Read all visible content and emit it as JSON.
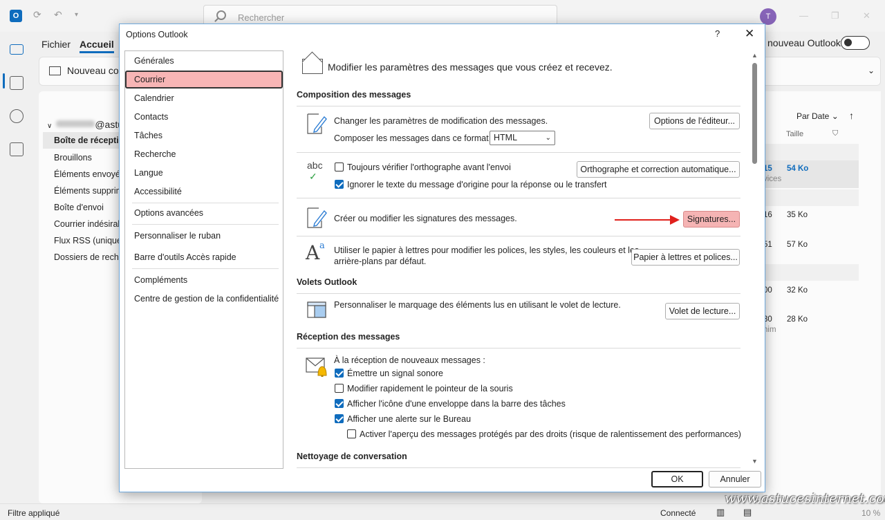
{
  "app": {
    "search_placeholder": "Rechercher",
    "avatar_initial": "T",
    "tabs": [
      "Fichier",
      "Accueil"
    ],
    "new_mail_label": "Nouveau cou",
    "toggle_label": "nouveau Outlook",
    "account_suffix": "@astuc",
    "folders": [
      "Boîte de réceptio",
      "Brouillons",
      "Éléments envoyé",
      "Éléments supprim",
      "Boîte d'envoi",
      "Courrier indésirab",
      "Flux RSS (uniquem",
      "Dossiers de recher"
    ],
    "sort_label": "Par Date",
    "size_col": "Taille",
    "messages": [
      {
        "time": "15",
        "size": "54 Ko",
        "sub": "vices"
      },
      {
        "time": "16",
        "size": "35 Ko",
        "sub": ""
      },
      {
        "time": "51",
        "size": "57 Ko",
        "sub": ""
      },
      {
        "time": "00",
        "size": "32 Ko",
        "sub": ""
      },
      {
        "time": "30",
        "size": "28 Ko",
        "sub": "him"
      }
    ],
    "status_left": "Filtre appliqué",
    "status_connected": "Connecté",
    "status_zoom": "10 %",
    "watermark": "www.astucesinternet.com"
  },
  "dialog": {
    "title": "Options Outlook",
    "help": "?",
    "close": "✕",
    "nav": [
      "Générales",
      "Courrier",
      "Calendrier",
      "Contacts",
      "Tâches",
      "Recherche",
      "Langue",
      "Accessibilité",
      "Options avancées",
      "Personnaliser le ruban",
      "Barre d'outils Accès rapide",
      "Compléments",
      "Centre de gestion de la confidentialité"
    ],
    "header": "Modifier les paramètres des messages que vous créez et recevez.",
    "sections": {
      "composition": "Composition des messages",
      "volets": "Volets Outlook",
      "reception": "Réception des messages",
      "nettoyage": "Nettoyage de conversation"
    },
    "editor_text": "Changer les paramètres de modification des messages.",
    "editor_btn": "Options de l'éditeur...",
    "format_label": "Composer les messages dans ce format :",
    "format_value": "HTML",
    "spell_check": "Toujours vérifier l'orthographe avant l'envoi",
    "spell_btn": "Orthographe et correction automatique...",
    "ignore_text": "Ignorer le texte du message d'origine pour la réponse ou le transfert",
    "abc_icon_text": "abc",
    "signature_text": "Créer ou modifier les signatures des messages.",
    "signature_btn": "Signatures...",
    "stationery_text_1": "Utiliser le papier à lettres pour modifier les polices, les styles, les couleurs et les",
    "stationery_text_2": "arrière-plans par défaut.",
    "stationery_btn": "Papier à lettres et polices...",
    "reading_text": "Personnaliser le marquage des éléments lus en utilisant le volet de lecture.",
    "reading_btn": "Volet de lecture...",
    "arrival_label": "À la réception de nouveaux messages :",
    "arrival_options": [
      {
        "label": "Émettre un signal sonore",
        "checked": true
      },
      {
        "label": "Modifier rapidement le pointeur de la souris",
        "checked": false
      },
      {
        "label": "Afficher l'icône d'une enveloppe dans la barre des tâches",
        "checked": true
      },
      {
        "label": "Afficher une alerte sur le Bureau",
        "checked": true
      }
    ],
    "preview_option": {
      "label": "Activer l'aperçu des messages protégés par des droits (risque de ralentissement des performances)",
      "checked": false
    },
    "spell_checked": false,
    "ignore_checked": true,
    "ok": "OK",
    "cancel": "Annuler"
  },
  "colors": {
    "accent": "#0f6cbd",
    "highlight": "#f7b5b5",
    "arrow": "#e0201c"
  }
}
